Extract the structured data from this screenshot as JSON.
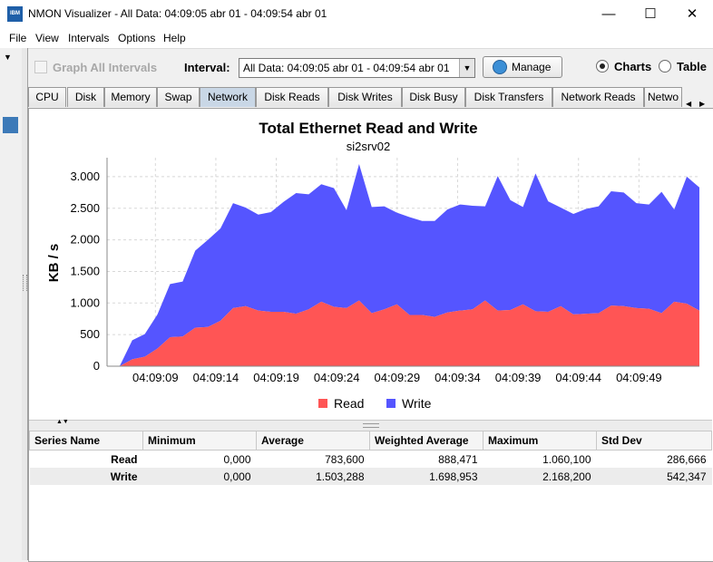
{
  "window": {
    "app_icon_text": "IBM",
    "title": "NMON Visualizer - All Data: 04:09:05 abr 01 - 04:09:54 abr 01",
    "minimize": "—",
    "maximize": "☐",
    "close": "✕"
  },
  "menu": [
    "File",
    "View",
    "Intervals",
    "Options",
    "Help"
  ],
  "toolbar": {
    "graph_all_label": "Graph All Intervals",
    "interval_label": "Interval:",
    "interval_value": "All Data: 04:09:05 abr 01 - 04:09:54 abr 01",
    "manage_label": "Manage",
    "charts_label": "Charts",
    "table_label": "Table",
    "selected_view": "Charts"
  },
  "tabs": [
    "CPU",
    "Disk",
    "Memory",
    "Swap",
    "Network",
    "Disk Reads",
    "Disk Writes",
    "Disk Busy",
    "Disk Transfers",
    "Network Reads",
    "Netwo"
  ],
  "active_tab": "Network",
  "chart_data": {
    "type": "area",
    "stacked": true,
    "title": "Total Ethernet Read and Write",
    "subtitle": "si2srv02",
    "ylabel": "KB / s",
    "xlabel": "",
    "ylim": [
      0,
      3300
    ],
    "y_ticks": [
      "0",
      "500",
      "1.000",
      "1.500",
      "2.000",
      "2.500",
      "3.000"
    ],
    "x_tick_labels": [
      "04:09:09",
      "04:09:14",
      "04:09:19",
      "04:09:24",
      "04:09:29",
      "04:09:34",
      "04:09:39",
      "04:09:44",
      "04:09:49"
    ],
    "x_start_second": 5,
    "x_tick_seconds": [
      9,
      14,
      19,
      24,
      29,
      34,
      39,
      44,
      49
    ],
    "x_end_second": 54,
    "grid": true,
    "legend_position": "bottom",
    "series": [
      {
        "name": "Read",
        "color": "#ff5555",
        "values": [
          0,
          0,
          110,
          150,
          280,
          460,
          470,
          610,
          620,
          720,
          920,
          950,
          880,
          860,
          860,
          830,
          900,
          1020,
          940,
          920,
          1040,
          840,
          900,
          980,
          810,
          810,
          780,
          850,
          880,
          900,
          1040,
          880,
          890,
          980,
          870,
          860,
          950,
          820,
          830,
          840,
          960,
          950,
          920,
          910,
          840,
          1020,
          990,
          880
        ]
      },
      {
        "name": "Write",
        "color": "#5555ff",
        "values": [
          0,
          0,
          300,
          360,
          540,
          840,
          870,
          1220,
          1380,
          1460,
          1660,
          1560,
          1520,
          1580,
          1740,
          1910,
          1820,
          1860,
          1880,
          1550,
          2160,
          1680,
          1630,
          1450,
          1550,
          1490,
          1520,
          1630,
          1680,
          1640,
          1490,
          2130,
          1740,
          1540,
          2180,
          1750,
          1560,
          1590,
          1660,
          1690,
          1810,
          1800,
          1660,
          1650,
          1920,
          1460,
          2010,
          1950
        ]
      }
    ]
  },
  "stats_table": {
    "headers": [
      "Series Name",
      "Minimum",
      "Average",
      "Weighted Average",
      "Maximum",
      "Std Dev"
    ],
    "rows": [
      [
        "Read",
        "0,000",
        "783,600",
        "888,471",
        "1.060,100",
        "286,666"
      ],
      [
        "Write",
        "0,000",
        "1.503,288",
        "1.698,953",
        "2.168,200",
        "542,347"
      ]
    ]
  }
}
